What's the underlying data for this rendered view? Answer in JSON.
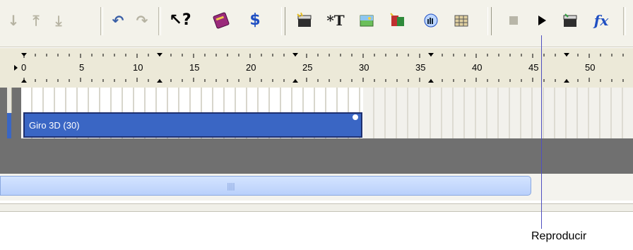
{
  "toolbar": {
    "groups": [
      {
        "icons": [
          "move-down-icon",
          "move-to-top-icon",
          "move-to-bottom-icon"
        ]
      },
      {
        "icons": [
          "undo-icon",
          "redo-icon"
        ]
      },
      {
        "icons": [
          "help-cursor-icon",
          "book-icon",
          "dollar-icon"
        ]
      },
      {
        "icons": [
          "clapper-icon",
          "text-icon",
          "image-icon",
          "transition-icon",
          "hand-icon",
          "film-grid-icon"
        ]
      },
      {
        "icons": [
          "stop-icon",
          "play-icon",
          "clapper-add-icon",
          "effects-icon"
        ]
      }
    ]
  },
  "ruler": {
    "labels": [
      "0",
      "5",
      "10",
      "15",
      "20",
      "25",
      "30",
      "35",
      "40",
      "45",
      "50"
    ]
  },
  "timeline": {
    "clip": {
      "label": "Giro 3D (30)",
      "color": "#3a66c4"
    }
  },
  "callout": {
    "text": "Reproducir"
  },
  "colors": {
    "toolbar_bg": "#f3f2ea",
    "timeline_bg": "#707070",
    "scroll_thumb": "#c6dafc"
  }
}
